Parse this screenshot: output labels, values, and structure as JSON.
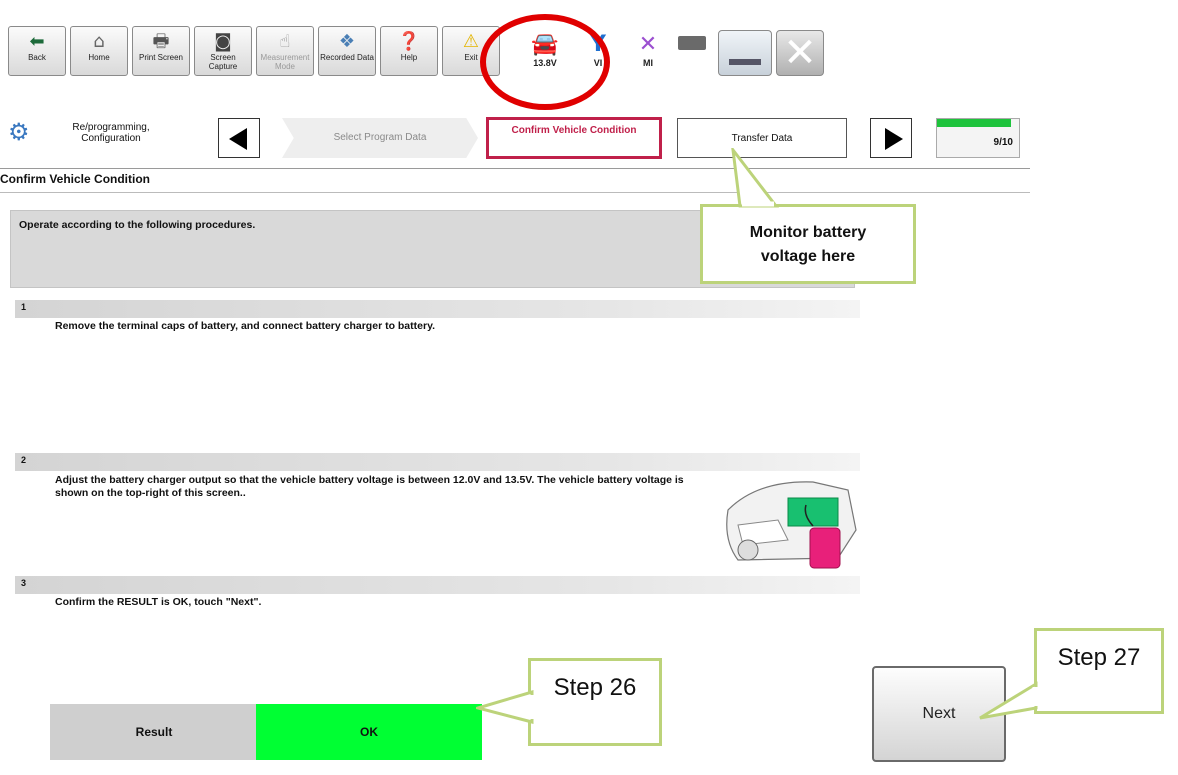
{
  "toolbar": {
    "buttons": [
      {
        "label": "Back",
        "icon": "back-arrow-icon"
      },
      {
        "label": "Home",
        "icon": "home-icon"
      },
      {
        "label": "Print Screen",
        "icon": "printer-icon"
      },
      {
        "label": "Screen Capture",
        "icon": "camera-icon"
      },
      {
        "label": "Measurement Mode",
        "icon": "hand-pointer-icon"
      },
      {
        "label": "Recorded Data",
        "icon": "recorded-data-icon"
      },
      {
        "label": "Help",
        "icon": "help-icon"
      },
      {
        "label": "Exit",
        "icon": "warning-icon"
      }
    ],
    "battery_voltage": "13.8V",
    "vi_label": "VI",
    "mi_label": "MI"
  },
  "nav": {
    "section_label": "Re/programming, Configuration",
    "step_prev": "Select Program Data",
    "step_current": "Confirm Vehicle Condition",
    "step_next": "Transfer Data",
    "progress": "9/10",
    "progress_fraction": 0.9
  },
  "page": {
    "title": "Confirm Vehicle Condition",
    "instruction": "Operate according to the following procedures."
  },
  "steps": [
    {
      "num": "1",
      "text": "Remove the terminal caps of battery, and connect battery charger to battery."
    },
    {
      "num": "2",
      "text": "Adjust the battery charger output so that the vehicle battery voltage is between 12.0V and 13.5V. The vehicle battery voltage is shown on the top-right of this screen.."
    },
    {
      "num": "3",
      "text": "Confirm the RESULT is OK, touch \"Next\"."
    }
  ],
  "result": {
    "label": "Result",
    "value": "OK"
  },
  "next_label": "Next",
  "callouts": {
    "battery": "Monitor battery voltage here",
    "step26": "Step 26",
    "step27": "Step 27"
  },
  "colors": {
    "ok_green": "#00ff33",
    "progress_green": "#1ec33c",
    "current_step": "#c0204a",
    "callout_border": "#bcd37a",
    "highlight_ring": "#e00000"
  }
}
